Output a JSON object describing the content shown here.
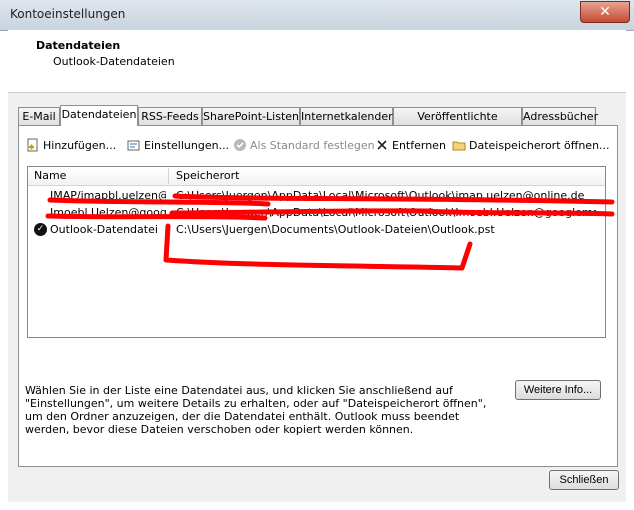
{
  "window": {
    "title": "Kontoeinstellungen",
    "close_glyph": "✕"
  },
  "header": {
    "title": "Datendateien",
    "subtitle": "Outlook-Datendateien"
  },
  "tabs": [
    {
      "label": "E-Mail",
      "active": false
    },
    {
      "label": "Datendateien",
      "active": true
    },
    {
      "label": "RSS-Feeds",
      "active": false
    },
    {
      "label": "SharePoint-Listen",
      "active": false
    },
    {
      "label": "Internetkalender",
      "active": false
    },
    {
      "label": "Veröffentlichte Kalender",
      "active": false
    },
    {
      "label": "Adressbücher",
      "active": false
    }
  ],
  "toolbar": {
    "add": "Hinzufügen...",
    "settings": "Einstellungen...",
    "set_default": "Als Standard festlegen",
    "remove": "Entfernen",
    "open_location": "Dateispeicherort öffnen..."
  },
  "list": {
    "columns": {
      "name": "Name",
      "location": "Speicherort"
    },
    "rows": [
      {
        "name": "IMAP/imapbl.uelzen@...",
        "location": "C:\\Users\\Juergen\\AppData\\Local\\Microsoft\\Outlook\\imap.uelzen@online.de",
        "default": false
      },
      {
        "name": "Imoebl.Uelzen@googl...",
        "location": "C:\\Users\\Juergen\\AppData\\Local\\Microsoft\\Outlook\\Imoebl.Uelzen@googlemail.com",
        "default": false
      },
      {
        "name": "Outlook-Datendatei",
        "location": "C:\\Users\\Juergen\\Documents\\Outlook-Dateien\\Outlook.pst",
        "default": true
      }
    ]
  },
  "description": "Wählen Sie in der Liste eine Datendatei aus, und klicken Sie anschließend auf \"Einstellungen\", um weitere Details zu erhalten, oder auf \"Dateispeicherort öffnen\", um den Ordner anzuzeigen, der die Datendatei enthält. Outlook muss beendet werden, bevor diese Dateien verschoben oder kopiert werden können.",
  "buttons": {
    "more_info": "Weitere Info...",
    "close": "Schließen"
  },
  "annotation_color": "#ff0000"
}
